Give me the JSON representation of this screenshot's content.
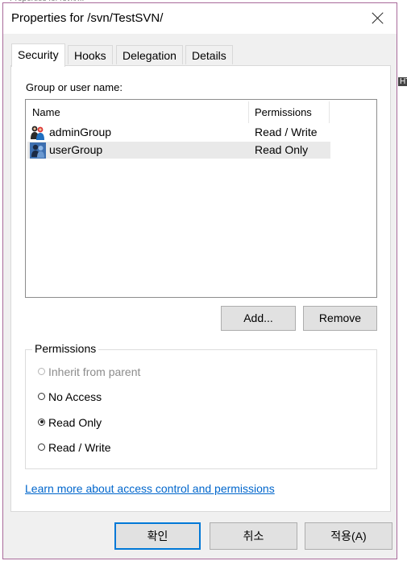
{
  "window": {
    "title": "Properties for /svn/TestSVN/"
  },
  "tabs": [
    {
      "label": "Security",
      "active": true
    },
    {
      "label": "Hooks"
    },
    {
      "label": "Delegation"
    },
    {
      "label": "Details"
    }
  ],
  "security": {
    "group_label": "Group or user name:",
    "columns": {
      "name": "Name",
      "permissions": "Permissions"
    },
    "rows": [
      {
        "name": "adminGroup",
        "permission": "Read / Write",
        "selected": false,
        "icon": "group-icon"
      },
      {
        "name": "userGroup",
        "permission": "Read Only",
        "selected": true,
        "icon": "group-icon"
      }
    ],
    "add_label": "Add...",
    "remove_label": "Remove",
    "permissions_legend": "Permissions",
    "options": [
      {
        "label": "Inherit from parent",
        "enabled": false,
        "checked": false
      },
      {
        "label": "No Access",
        "enabled": true,
        "checked": false
      },
      {
        "label": "Read Only",
        "enabled": true,
        "checked": true
      },
      {
        "label": "Read / Write",
        "enabled": true,
        "checked": false
      }
    ],
    "link_text": "Learn more about access control and permissions"
  },
  "footer": {
    "ok_label": "확인",
    "cancel_label": "취소",
    "apply_label": "적용(A)"
  },
  "colors": {
    "accent": "#0078d7",
    "link": "#0066cc",
    "window_bg": "#f0f0f0",
    "window_border": "#a86a9a"
  }
}
